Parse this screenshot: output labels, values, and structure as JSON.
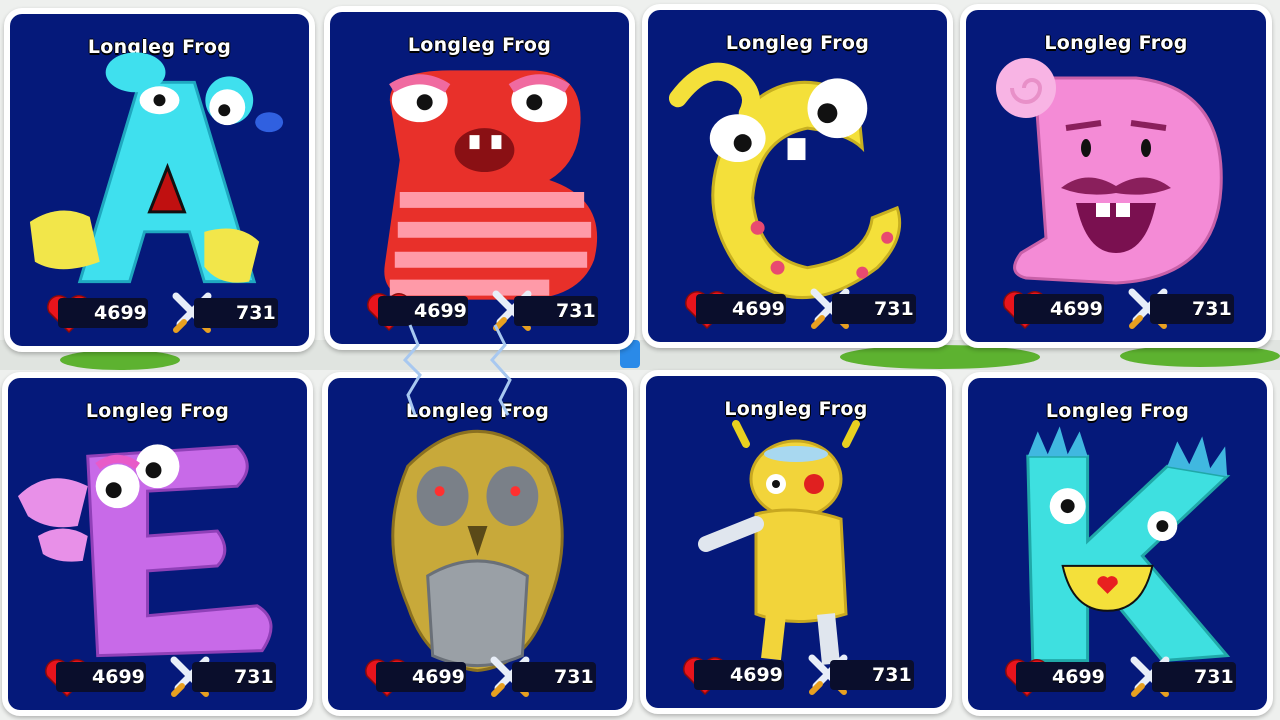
{
  "cards": [
    {
      "name": "Longleg Frog",
      "hp": "4699",
      "attack": "731",
      "letter": "A",
      "body": "#3fe0ee",
      "accent": "#f2e64a"
    },
    {
      "name": "Longleg Frog",
      "hp": "4699",
      "attack": "731",
      "letter": "B",
      "body": "#e8302a",
      "accent": "#ff9aa8"
    },
    {
      "name": "Longleg Frog",
      "hp": "4699",
      "attack": "731",
      "letter": "C",
      "body": "#f4e03a",
      "accent": "#e84a70"
    },
    {
      "name": "Longleg Frog",
      "hp": "4699",
      "attack": "731",
      "letter": "D",
      "body": "#f48bd6",
      "accent": "#8a1f5c"
    },
    {
      "name": "Longleg Frog",
      "hp": "4699",
      "attack": "731",
      "letter": "E",
      "body": "#c86ae8",
      "accent": "#e85ac8"
    },
    {
      "name": "Longleg Frog",
      "hp": "4699",
      "attack": "731",
      "letter": "mask",
      "body": "#c8a93a",
      "accent": "#9aa0a6"
    },
    {
      "name": "Longleg Frog",
      "hp": "4699",
      "attack": "731",
      "letter": "figure",
      "body": "#f2d43a",
      "accent": "#a8c8e8"
    },
    {
      "name": "Longleg Frog",
      "hp": "4699",
      "attack": "731",
      "letter": "K",
      "body": "#3ee0e0",
      "accent": "#f4e03a"
    }
  ],
  "colors": {
    "card_bg": "#05197a",
    "heart": "#e8141c",
    "stat_bg": "#0a0e2c"
  }
}
